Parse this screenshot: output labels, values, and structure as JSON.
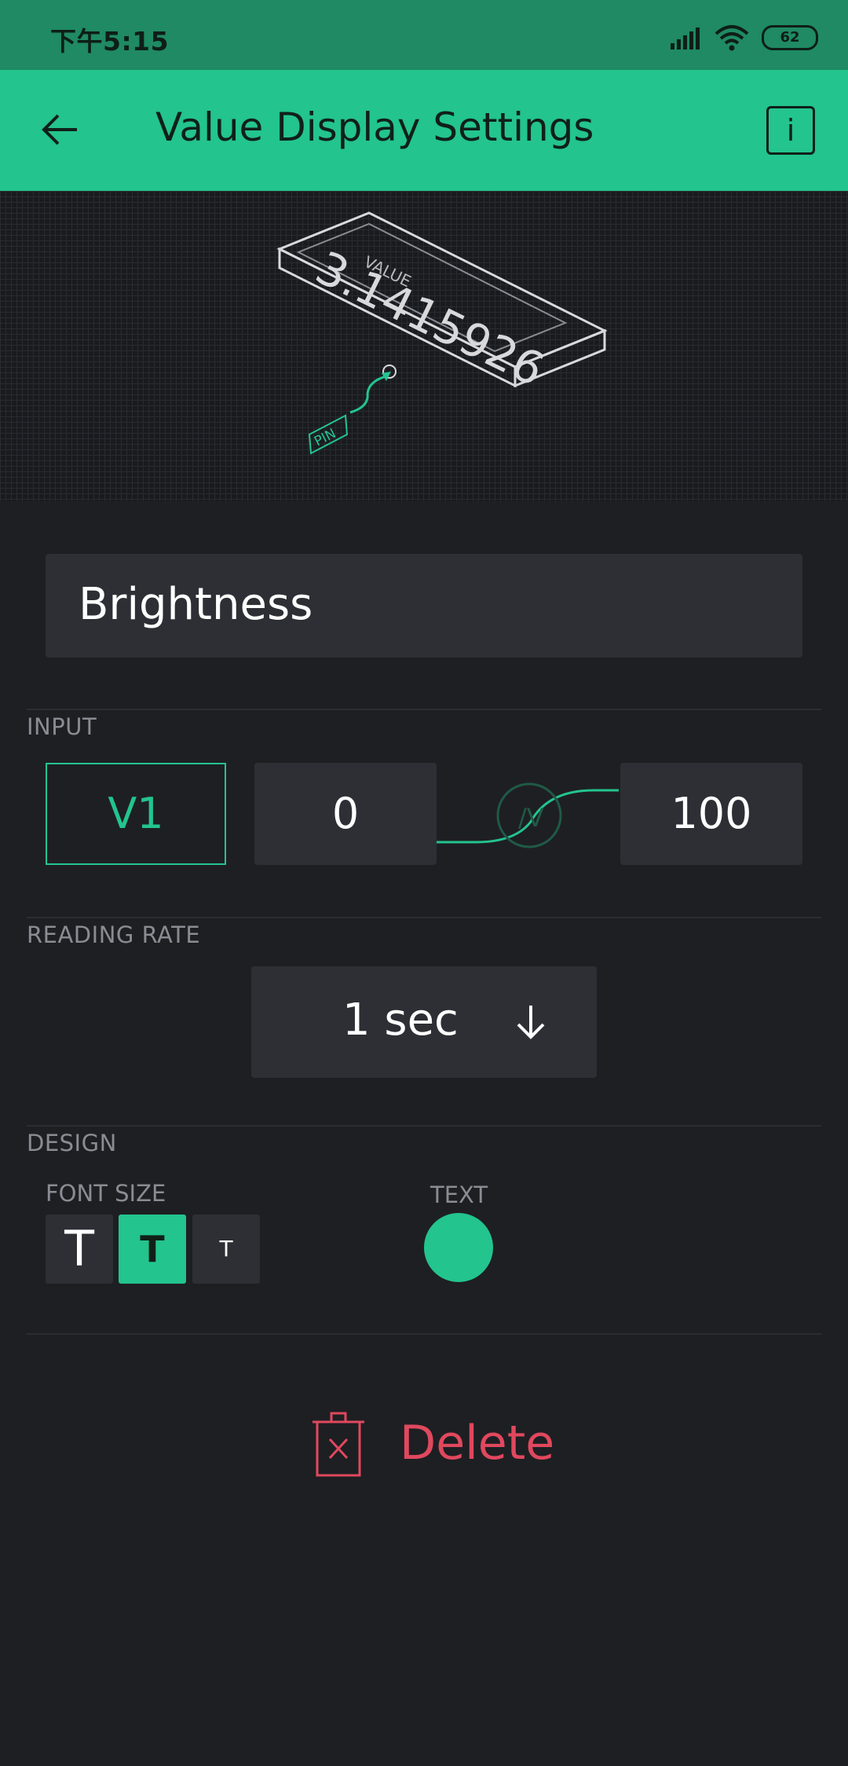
{
  "status_bar": {
    "time": "下午5:15",
    "battery": "62"
  },
  "header": {
    "title": "Value Display Settings",
    "info_label": "i"
  },
  "preview": {
    "display_label": "VALUE",
    "display_value": "3.1415926",
    "pin_label": "PIN"
  },
  "name_field": {
    "value": "Brightness"
  },
  "input": {
    "section_label": "INPUT",
    "pin": "V1",
    "min": "0",
    "max": "100",
    "map_label": "/V"
  },
  "reading_rate": {
    "section_label": "READING RATE",
    "value": "1 sec"
  },
  "design": {
    "section_label": "DESIGN",
    "font_size_label": "FONT SIZE",
    "font_size_options": [
      "T",
      "T",
      "T"
    ],
    "selected_font_size": 1,
    "text_label": "TEXT",
    "text_color": "#23c48e"
  },
  "delete": {
    "label": "Delete"
  },
  "colors": {
    "accent": "#23c48e",
    "background": "#1e1f23",
    "danger": "#e0485e"
  }
}
